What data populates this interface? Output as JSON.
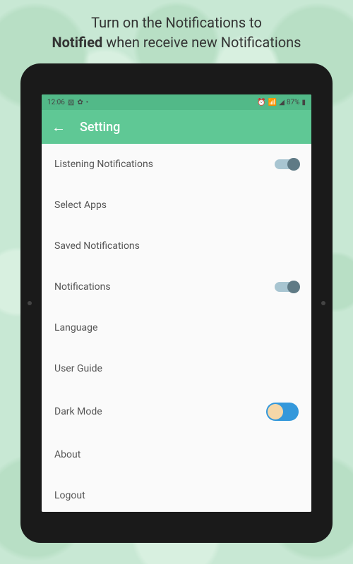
{
  "promo": {
    "line1": "Turn on the Notifications  to",
    "bold_word": "Notified",
    "line2_rest": " when receive new Notifications"
  },
  "status_bar": {
    "time": "12:06",
    "battery": "87%"
  },
  "app_bar": {
    "title": "Setting"
  },
  "settings": {
    "items": [
      {
        "label": "Listening Notifications",
        "toggle": true,
        "toggle_on": true,
        "toggle_style": "small"
      },
      {
        "label": "Select Apps",
        "toggle": false
      },
      {
        "label": "Saved Notifications",
        "toggle": false
      },
      {
        "label": "Notifications",
        "toggle": true,
        "toggle_on": true,
        "toggle_style": "small"
      },
      {
        "label": "Language",
        "toggle": false
      },
      {
        "label": "User Guide",
        "toggle": false
      },
      {
        "label": "Dark Mode",
        "toggle": true,
        "toggle_on": false,
        "toggle_style": "large"
      },
      {
        "label": "About",
        "toggle": false
      },
      {
        "label": "Logout",
        "toggle": false
      }
    ]
  },
  "colors": {
    "accent_green": "#5fc895",
    "status_green": "#52b988",
    "toggle_track": "#a8c5d1",
    "toggle_thumb": "#5f7a85",
    "darkmode_track": "#3498db",
    "darkmode_thumb": "#f5d7a8"
  }
}
